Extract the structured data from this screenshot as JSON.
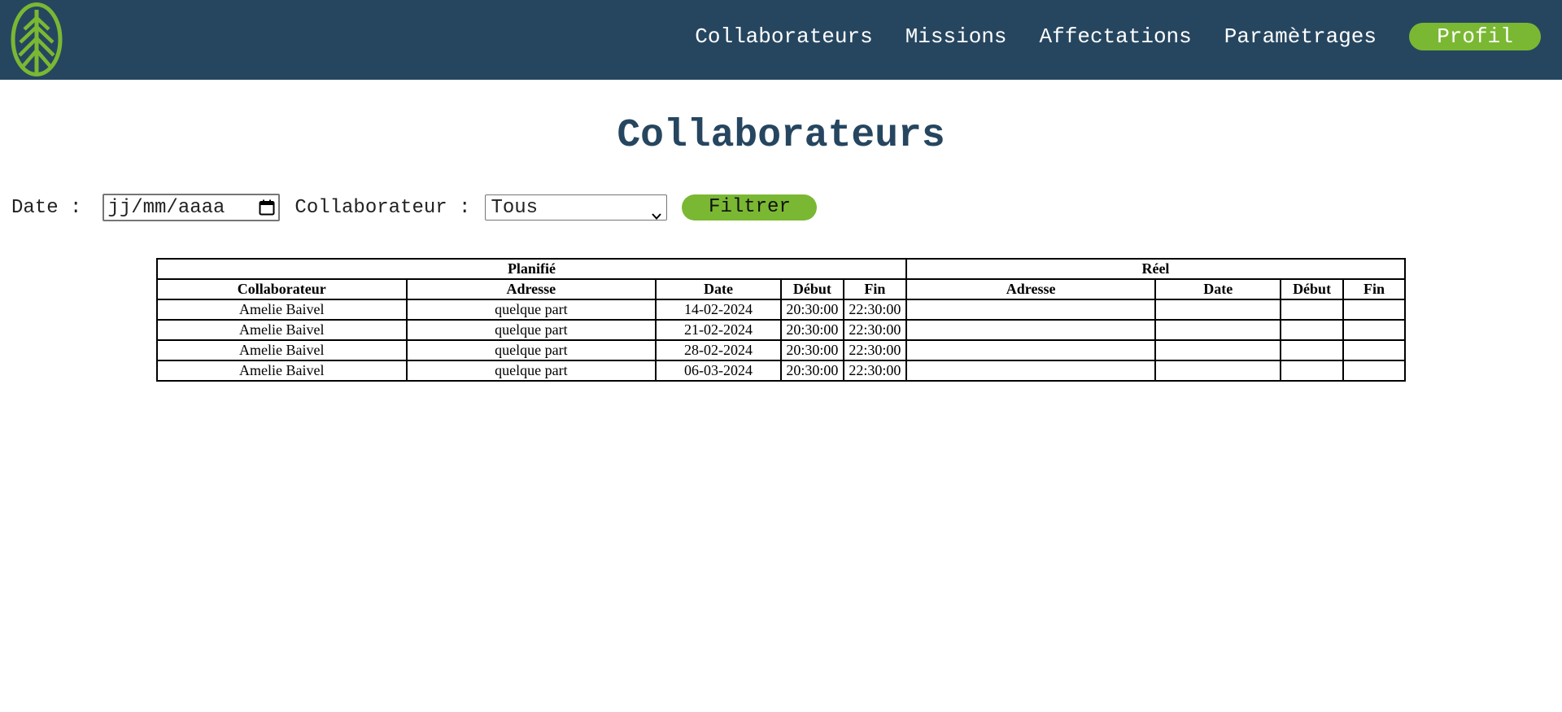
{
  "nav": {
    "logo_icon": "tree-logo",
    "links": [
      "Collaborateurs",
      "Missions",
      "Affectations",
      "Paramètrages"
    ],
    "profile_label": "Profil"
  },
  "page": {
    "title": "Collaborateurs"
  },
  "filters": {
    "date_label": "Date :",
    "date_placeholder": "jj/mm/aaaa",
    "collaborator_label": "Collaborateur :",
    "collaborator_selected": "Tous",
    "filter_button": "Filtrer"
  },
  "table": {
    "group_headers": {
      "planned": "Planifié",
      "actual": "Réel"
    },
    "columns": [
      "Collaborateur",
      "Adresse",
      "Date",
      "Début",
      "Fin",
      "Adresse",
      "Date",
      "Début",
      "Fin"
    ],
    "rows": [
      [
        "Amelie Baivel",
        "quelque part",
        "14-02-2024",
        "20:30:00",
        "22:30:00",
        "",
        "",
        "",
        ""
      ],
      [
        "Amelie Baivel",
        "quelque part",
        "21-02-2024",
        "20:30:00",
        "22:30:00",
        "",
        "",
        "",
        ""
      ],
      [
        "Amelie Baivel",
        "quelque part",
        "28-02-2024",
        "20:30:00",
        "22:30:00",
        "",
        "",
        "",
        ""
      ],
      [
        "Amelie Baivel",
        "quelque part",
        "06-03-2024",
        "20:30:00",
        "22:30:00",
        "",
        "",
        "",
        ""
      ]
    ]
  },
  "colors": {
    "navbar": "#264660",
    "accent": "#7ab833",
    "title": "#264660"
  }
}
